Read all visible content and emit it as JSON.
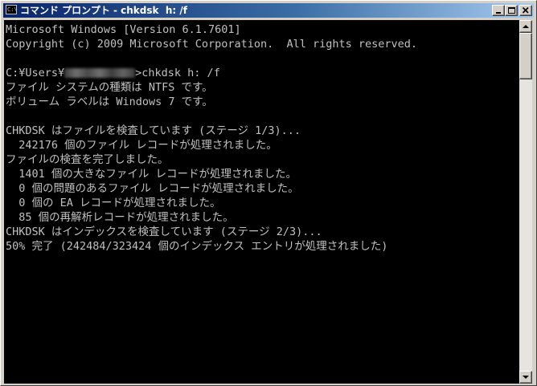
{
  "window": {
    "title": "コマンド プロンプト - chkdsk  h: /f",
    "app_icon_text": "C:\\",
    "controls": {
      "minimize": "minimize",
      "maximize": "maximize",
      "close": "close"
    }
  },
  "console": {
    "lines": [
      "Microsoft Windows [Version 6.1.7601]",
      "Copyright (c) 2009 Microsoft Corporation.  All rights reserved.",
      "",
      "C:¥Users¥",
      "ファイル システムの種類は NTFS です。",
      "ボリューム ラベルは Windows 7 です。",
      "",
      "CHKDSK はファイルを検査しています (ステージ 1/3)...",
      "  242176 個のファイル レコードが処理されました。",
      "ファイルの検査を完了しました。",
      "  1401 個の大きなファイル レコードが処理されました。",
      "  0 個の問題のあるファイル レコードが処理されました。",
      "  0 個の EA レコードが処理されました。",
      "  85 個の再解析レコードが処理されました。",
      "CHKDSK はインデックスを検査しています (ステージ 2/3)...",
      "50% 完了 (242484/323424 個のインデックス エントリが処理されました)"
    ],
    "prompt_command": ">chkdsk h: /f"
  },
  "colors": {
    "console_background": "#000000",
    "console_text": "#c0c0c0",
    "titlebar_start": "#0a246a",
    "titlebar_end": "#a6caf0",
    "frame": "#d4d0c8"
  },
  "scrollbar": {
    "position": 0
  }
}
